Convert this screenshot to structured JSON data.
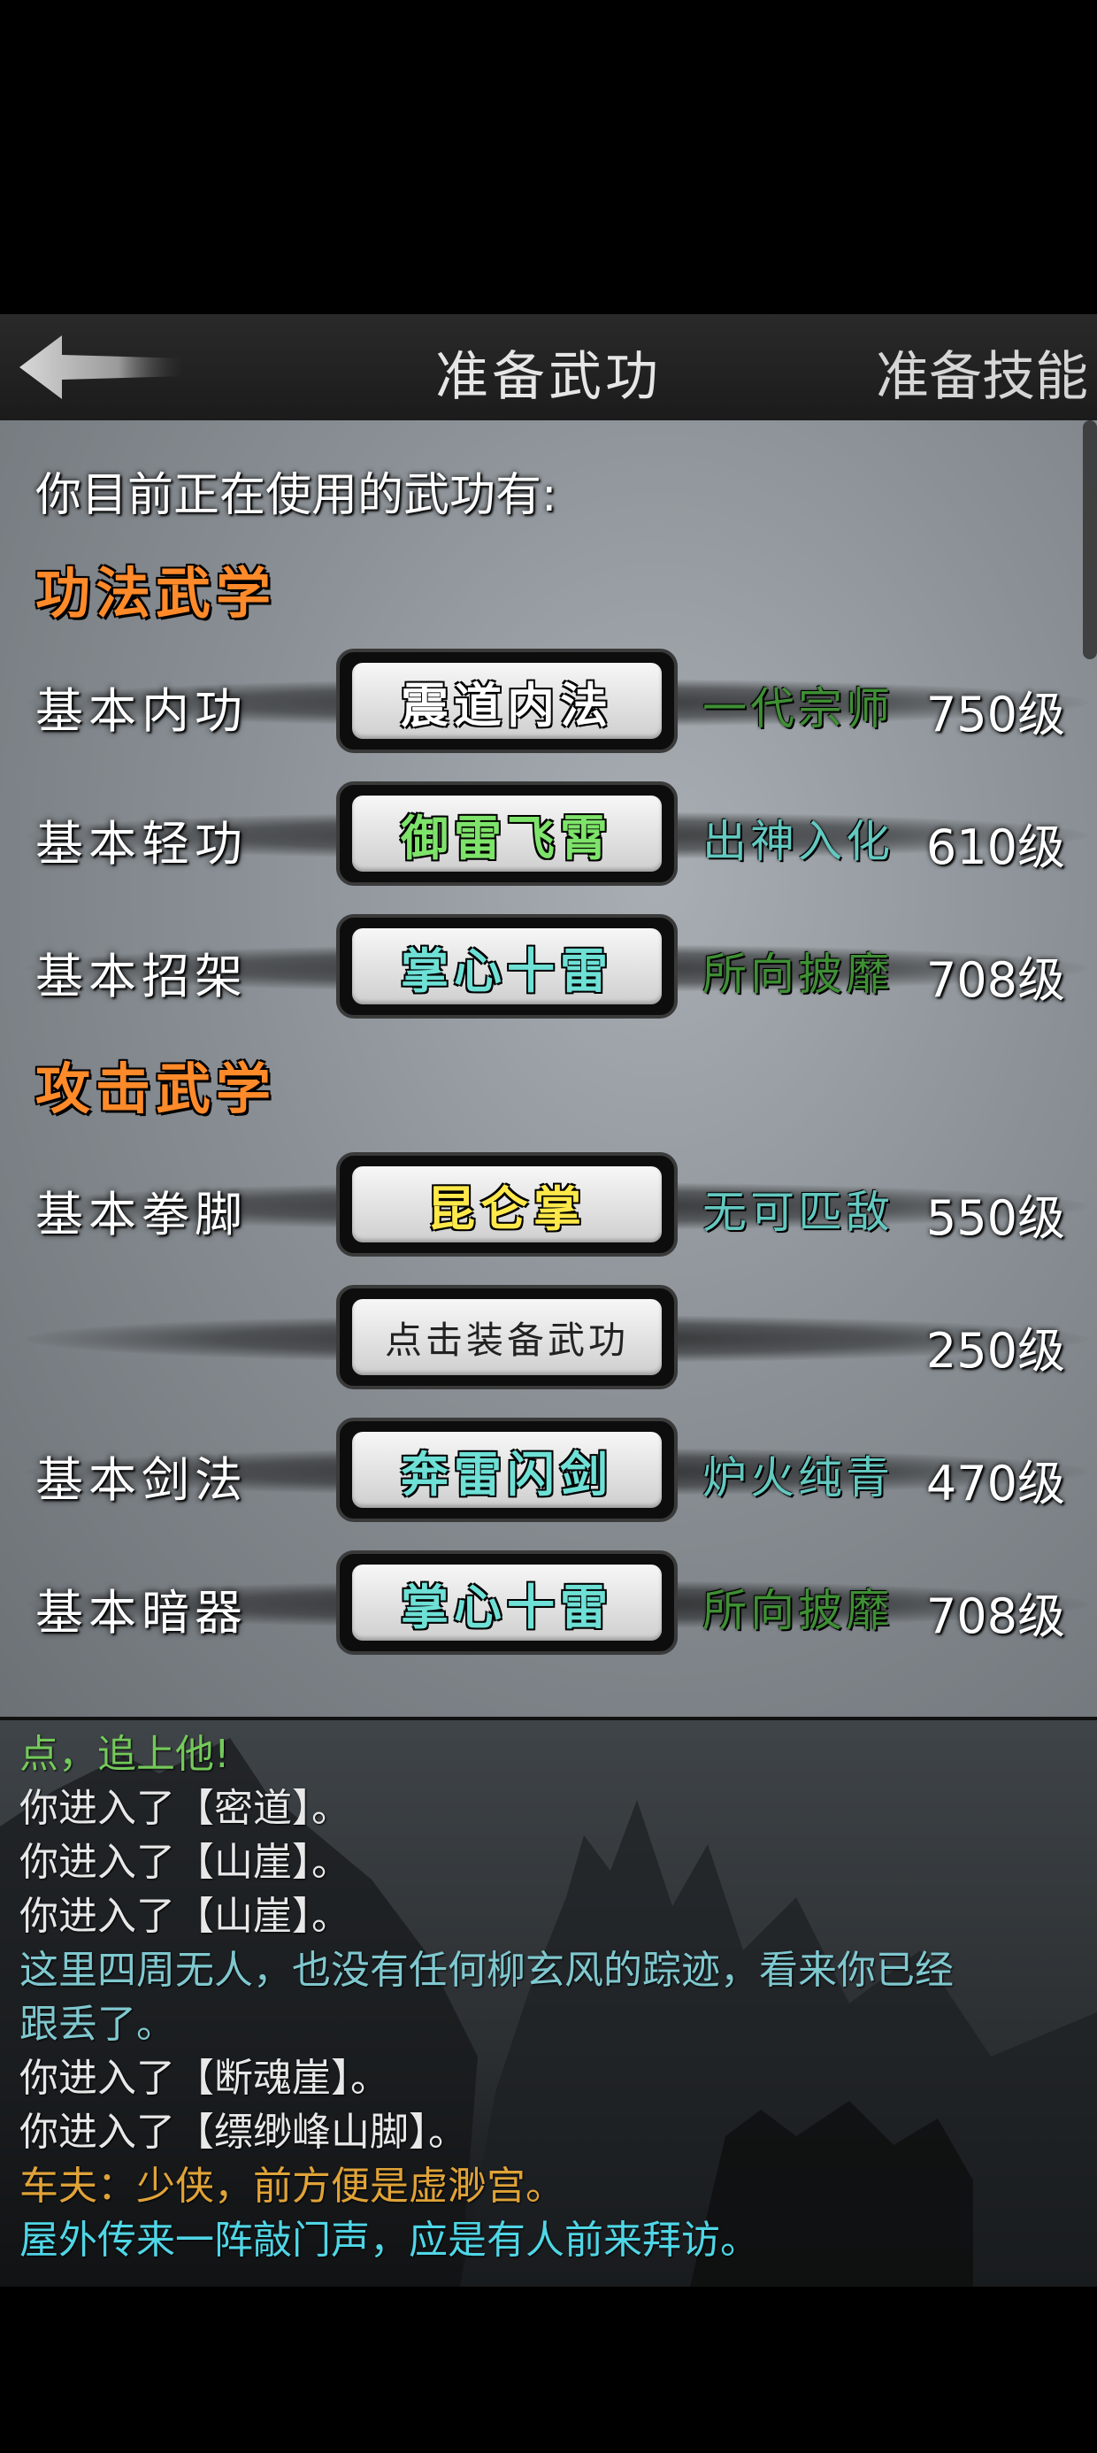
{
  "header": {
    "title": "准备武功",
    "skill_tab": "准备技能",
    "back_icon": "back-arrow-icon"
  },
  "intro": "你目前正在使用的武功有:",
  "sections": [
    {
      "title": "功法武学",
      "rows": [
        {
          "label": "基本内功",
          "skill": "震道内法",
          "skill_color": "#ffffff",
          "rank": "一代宗师",
          "rank_color": "#3f8f35",
          "level": "750级"
        },
        {
          "label": "基本轻功",
          "skill": "御雷飞霄",
          "skill_color": "#7ee36a",
          "rank": "出神入化",
          "rank_color": "#63c8c0",
          "level": "610级"
        },
        {
          "label": "基本招架",
          "skill": "掌心十雷",
          "skill_color": "#6ee0d6",
          "rank": "所向披靡",
          "rank_color": "#3f8f35",
          "level": "708级"
        }
      ]
    },
    {
      "title": "攻击武学",
      "rows": [
        {
          "label": "基本拳脚",
          "skill": "昆仑掌",
          "skill_color": "#ffe94a",
          "rank": "无可匹敌",
          "rank_color": "#63c8c0",
          "level": "550级"
        },
        {
          "label": "",
          "skill": "点击装备武功",
          "skill_color": "#222222",
          "rank": "",
          "rank_color": "#ffffff",
          "level": "250级",
          "empty": true
        },
        {
          "label": "基本剑法",
          "skill": "奔雷闪剑",
          "skill_color": "#6ee0d6",
          "rank": "炉火纯青",
          "rank_color": "#63c8c0",
          "level": "470级"
        },
        {
          "label": "基本暗器",
          "skill": "掌心十雷",
          "skill_color": "#6ee0d6",
          "rank": "所向披靡",
          "rank_color": "#3f8f35",
          "level": "708级"
        }
      ]
    }
  ],
  "log": [
    {
      "text": "点，追上他!",
      "color": "#74c95a"
    },
    {
      "text": "你进入了【密道】。",
      "color": "#e8e8e8"
    },
    {
      "text": "你进入了【山崖】。",
      "color": "#e8e8e8"
    },
    {
      "text": "你进入了【山崖】。",
      "color": "#e8e8e8"
    },
    {
      "text": "这里四周无人，也没有任何柳玄风的踪迹，看来你已经",
      "color": "#7fc8cf"
    },
    {
      "text": "跟丢了。",
      "color": "#7fc8cf"
    },
    {
      "text": "你进入了【断魂崖】。",
      "color": "#e8e8e8"
    },
    {
      "text": "你进入了【缥缈峰山脚】。",
      "color": "#e8e8e8"
    },
    {
      "text": "车夫：少侠，前方便是虚渺宫。",
      "color": "#e0a338"
    },
    {
      "text": "屋外传来一阵敲门声，应是有人前来拜访。",
      "color": "#4fd6e6"
    }
  ]
}
